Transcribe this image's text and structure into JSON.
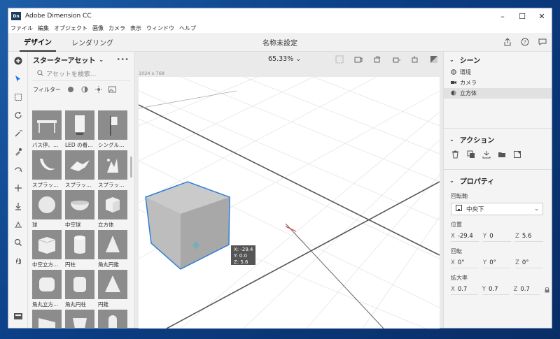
{
  "window": {
    "app_logo": "Dn",
    "title": "Adobe Dimension CC",
    "controls": [
      "minimize-icon",
      "maximize-icon",
      "close-icon"
    ]
  },
  "menu": [
    "ファイル",
    "編集",
    "オブジェクト",
    "画像",
    "カメラ",
    "表示",
    "ウィンドウ",
    "ヘルプ"
  ],
  "tabs": {
    "design": "デザイン",
    "render": "レンダリング"
  },
  "document_title": "名称未設定",
  "tabbar_icons": [
    "share-icon",
    "help-icon",
    "chat-icon"
  ],
  "tools": [
    "add-icon",
    "select-icon",
    "select-box-icon",
    "orbit-icon",
    "magic-wand-icon",
    "eyedropper-icon",
    "pan-tool-icon",
    "move-icon",
    "drop-icon",
    "align-icon",
    "zoom-icon",
    "hand-icon"
  ],
  "assets": {
    "title": "スターターアセット",
    "more": "•••",
    "search_placeholder": "アセットを検索...",
    "filter_label": "フィルター",
    "items": [
      {
        "label": "バス停、…"
      },
      {
        "label": "LED の看…"
      },
      {
        "label": "シングル…"
      },
      {
        "label": "スプラッ…"
      },
      {
        "label": "スプラッ…"
      },
      {
        "label": "スプラッ…"
      },
      {
        "label": "球"
      },
      {
        "label": "中空球"
      },
      {
        "label": "立方体"
      },
      {
        "label": "中空立方…"
      },
      {
        "label": "円柱"
      },
      {
        "label": "角丸円錐"
      },
      {
        "label": "角丸立方…"
      },
      {
        "label": "角丸円柱"
      },
      {
        "label": "円錐"
      },
      {
        "label": ""
      },
      {
        "label": ""
      },
      {
        "label": ""
      }
    ]
  },
  "viewport": {
    "zoom": "65.33%",
    "dimensions": "1024 x 768",
    "readout": {
      "x": "X: -29.4",
      "y": "Y:   0.0",
      "z": "Z:   5.6"
    }
  },
  "scene": {
    "title": "シーン",
    "items": [
      {
        "label": "環境",
        "icon": "environment-icon"
      },
      {
        "label": "カメラ",
        "icon": "camera-icon"
      },
      {
        "label": "立方体",
        "icon": "cube-icon"
      }
    ]
  },
  "actions": {
    "title": "アクション"
  },
  "properties": {
    "title": "プロパティ",
    "pivot_label": "回転軸",
    "pivot_value": "中央下",
    "position_label": "位置",
    "position": {
      "x": "-29.4",
      "y": "0",
      "z": "5.6"
    },
    "rotation_label": "回転",
    "rotation": {
      "x": "0°",
      "y": "0°",
      "z": "0°"
    },
    "scale_label": "拡大率",
    "scale": {
      "x": "0.7",
      "y": "0.7",
      "z": "0.7"
    }
  },
  "colors": {
    "accent": "#1473e6",
    "selection": "#2f7fd6"
  }
}
